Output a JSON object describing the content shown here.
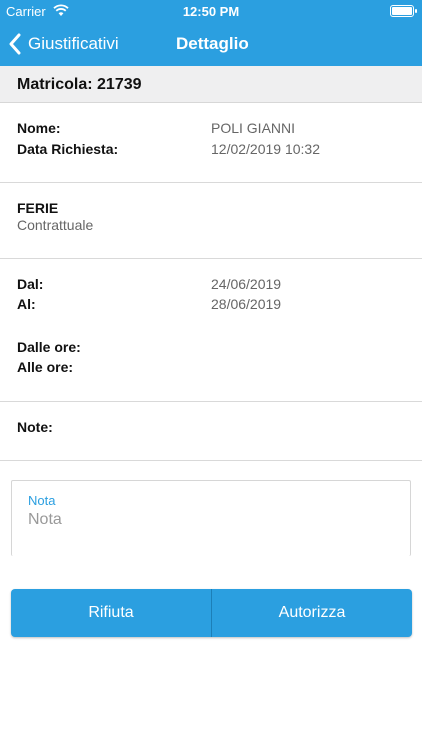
{
  "status": {
    "carrier": "Carrier",
    "time": "12:50 PM"
  },
  "nav": {
    "back_label": "Giustificativi",
    "title": "Dettaglio"
  },
  "matricola": {
    "label": "Matricola:",
    "value": "21739"
  },
  "person": {
    "nome_label": "Nome:",
    "nome_value": "POLI GIANNI",
    "data_label": "Data Richiesta:",
    "data_value": "12/02/2019 10:32"
  },
  "tipo": {
    "title": "FERIE",
    "subtitle": "Contrattuale"
  },
  "periodo": {
    "dal_label": "Dal:",
    "dal_value": "24/06/2019",
    "al_label": "Al:",
    "al_value": "28/06/2019",
    "dalle_label": "Dalle ore:",
    "dalle_value": "",
    "alle_label": "Alle ore:",
    "alle_value": ""
  },
  "note": {
    "label": "Note:",
    "value": ""
  },
  "nota_field": {
    "label": "Nota",
    "placeholder": "Nota",
    "value": ""
  },
  "actions": {
    "reject": "Rifiuta",
    "approve": "Autorizza"
  },
  "colors": {
    "accent": "#2b9fe0",
    "header_bg": "#efeff0"
  }
}
